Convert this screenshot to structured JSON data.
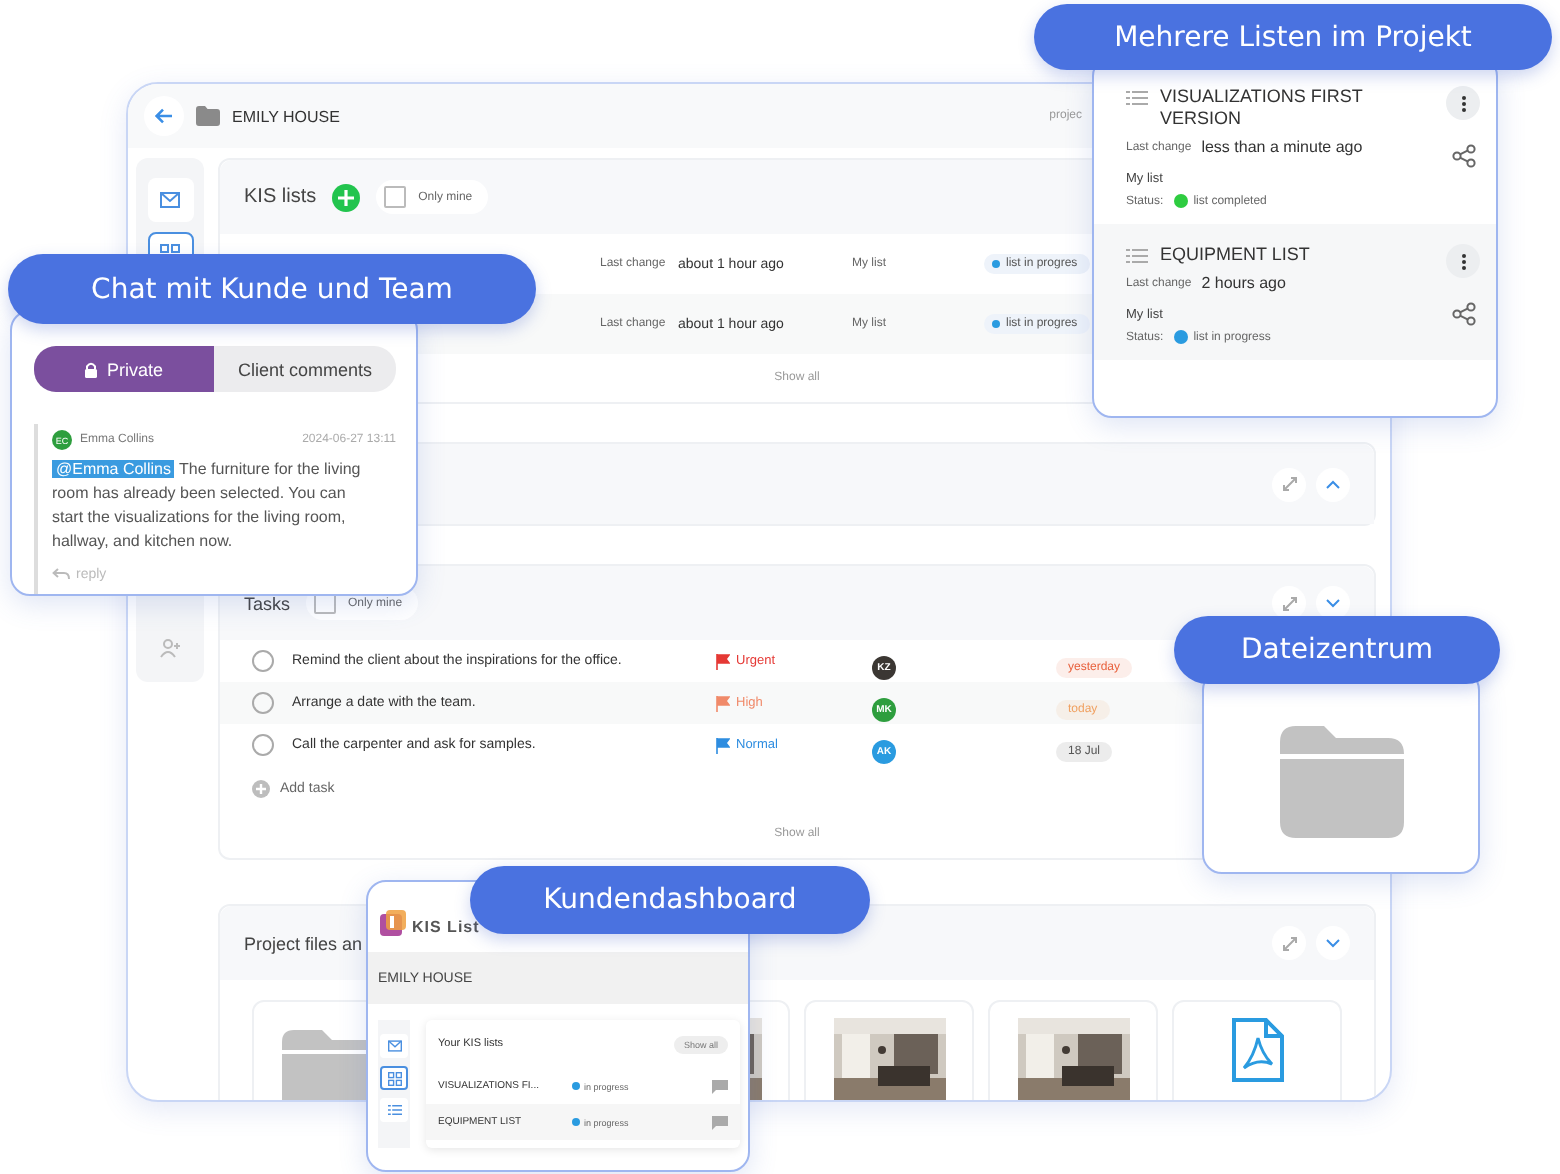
{
  "window": {
    "title": "EMILY HOUSE",
    "header_right": "projec"
  },
  "sidebar": [
    {
      "kind": "mail",
      "selected": false
    },
    {
      "kind": "grid",
      "selected": true
    },
    {
      "kind": "user",
      "selected": false
    }
  ],
  "kis_lists": {
    "title": "KIS lists",
    "only_mine": {
      "label": "Only mine",
      "checked": false
    },
    "rows": [
      {
        "last_change_label": "Last change",
        "last_change": "about 1 hour ago",
        "owner": "My list",
        "status": "list in progres"
      },
      {
        "last_change_label": "Last change",
        "last_change": "about 1 hour ago",
        "owner": "My list",
        "status": "list in progres"
      }
    ],
    "show_all": "Show all"
  },
  "tasks": {
    "title": "Tasks",
    "only_mine": {
      "label": "Only mine",
      "checked": false
    },
    "rows": [
      {
        "text": "Remind the client about the inspirations for the office.",
        "done": false,
        "priority": {
          "label": "Urgent",
          "color": "#e53935"
        },
        "assignee": {
          "initials": "KZ",
          "color": "#3b3733"
        },
        "due": {
          "label": "yesterday",
          "color": "#e8603c"
        }
      },
      {
        "text": "Arrange a date with the team.",
        "done": false,
        "priority": {
          "label": "High",
          "color": "#f08a6a"
        },
        "assignee": {
          "initials": "MK",
          "color": "#2e9e3e"
        },
        "due": {
          "label": "today",
          "color": "#f0a060"
        }
      },
      {
        "text": "Call the carpenter and ask for samples.",
        "done": false,
        "priority": {
          "label": "Normal",
          "color": "#2e8de0"
        },
        "assignee": {
          "initials": "AK",
          "color": "#2a9be0"
        },
        "due": {
          "label": "18 Jul",
          "color": "#555555"
        }
      }
    ],
    "add_task": "Add task",
    "show_all": "Show all"
  },
  "project_files": {
    "title": "Project files an",
    "files": [
      {
        "kind": "folder"
      },
      {
        "kind": "picture"
      },
      {
        "kind": "picture"
      },
      {
        "kind": "picture"
      },
      {
        "kind": "pdf"
      }
    ]
  },
  "lists_callout": {
    "label": "Mehrere Listen im Projekt",
    "lists": [
      {
        "title": "VISUALIZATIONS FIRST VERSION",
        "last_change_label": "Last change",
        "last_change": "less than a minute ago",
        "owner": "My list",
        "status_label": "Status:",
        "status": "list completed",
        "color": "#2ecc40"
      },
      {
        "title": "EQUIPMENT LIST",
        "last_change_label": "Last change",
        "last_change": "2 hours ago",
        "owner": "My list",
        "status_label": "Status:",
        "status": "list in progress",
        "color": "#2a9be0"
      }
    ]
  },
  "chat_callout": {
    "label": "Chat mit Kunde und Team",
    "tabs": [
      {
        "label": "Private",
        "selected": true
      },
      {
        "label": "Client comments",
        "selected": false
      }
    ],
    "comment": {
      "initials": "EC",
      "author": "Emma Collins",
      "time": "2024-06-27 13:11",
      "mention": "@Emma Collins",
      "text": " The furniture for the living room has already been selected. You can start the visualizations for the living room, hallway, and kitchen now.",
      "reply": "reply"
    }
  },
  "files_callout": {
    "label": "Dateizentrum"
  },
  "dashboard_callout": {
    "label": "Kundendashboard",
    "logo": "KIS List",
    "project": "EMILY HOUSE",
    "sidebar": [
      {
        "kind": "mail",
        "selected": false
      },
      {
        "kind": "grid",
        "selected": true
      },
      {
        "kind": "list",
        "selected": false
      }
    ],
    "panel_title": "Your KIS lists",
    "show_all": "Show all",
    "rows": [
      {
        "name": "VISUALIZATIONS FI...",
        "status": "in progress"
      },
      {
        "name": "EQUIPMENT LIST",
        "status": "in progress"
      }
    ]
  }
}
